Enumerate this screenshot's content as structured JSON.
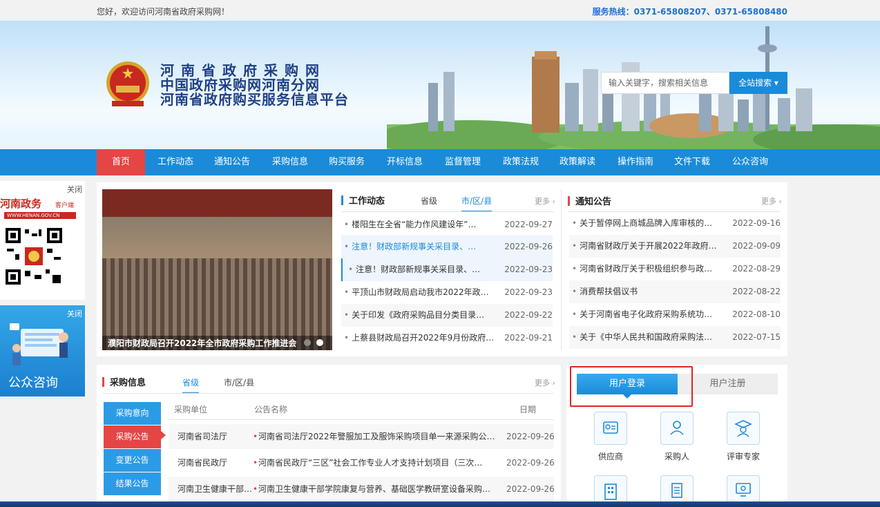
{
  "topbar": {
    "welcome": "您好，欢迎访问河南省政府采购网！",
    "hotline": "服务热线：0371-65808207、0371-65808480"
  },
  "header": {
    "title_lines": [
      "河南省政府采购网",
      "中国政府采购网河南分网",
      "河南省政府购买服务信息平台"
    ],
    "search_placeholder": "输入关键字，搜索相关信息",
    "search_button": "全站搜索"
  },
  "nav": {
    "items": [
      "首页",
      "工作动态",
      "通知公告",
      "采购信息",
      "购买服务",
      "开标信息",
      "监督管理",
      "政策法规",
      "政策解读",
      "操作指南",
      "文件下载",
      "公众咨询"
    ]
  },
  "left_ads": {
    "close": "关闭",
    "brand": "河南政务",
    "brand_suffix": "客户端",
    "url": "WWW.HENAN.GOV.CN",
    "close2": "关闭",
    "consult": "公众咨询"
  },
  "photo": {
    "caption": "濮阳市财政局召开2022年全市政府采购工作推进会"
  },
  "work_news": {
    "title": "工作动态",
    "tabs": [
      "省级",
      "市/区/县"
    ],
    "more": "更多",
    "items": [
      {
        "text": "楼阳生在全省“能力作风建设年”…",
        "date": "2022-09-27"
      },
      {
        "text": "注意！财政部新规事关采目录、…",
        "date": "2022-09-26"
      },
      {
        "text": "注意！财政部新规事关采目录、…",
        "date": "2022-09-23"
      },
      {
        "text": "平顶山市财政局启动我市2022年政…",
        "date": "2022-09-23"
      },
      {
        "text": "关于印发《政府采购品目分类目录…",
        "date": "2022-09-22"
      },
      {
        "text": "上蔡县财政局召开2022年9月份政府…",
        "date": "2022-09-21"
      }
    ]
  },
  "notices": {
    "title": "通知公告",
    "more": "更多",
    "items": [
      {
        "text": "关于暂停网上商城品牌入库审核的…",
        "date": "2022-09-16"
      },
      {
        "text": "河南省财政厅关于开展2022年政府…",
        "date": "2022-09-09"
      },
      {
        "text": "河南省财政厅关于积极组织参与政…",
        "date": "2022-08-29"
      },
      {
        "text": "消费帮扶倡议书",
        "date": "2022-08-22"
      },
      {
        "text": "关于河南省电子化政府采购系统功…",
        "date": "2022-08-10"
      },
      {
        "text": "关于《中华人民共和国政府采购法…",
        "date": "2022-07-15"
      }
    ]
  },
  "procurement": {
    "title": "采购信息",
    "tabs": [
      "省级",
      "市/区/县"
    ],
    "more": "更多",
    "menu": [
      "采购意向",
      "采购公告",
      "变更公告",
      "结果公告"
    ],
    "col_unit": "采购单位",
    "col_name": "公告名称",
    "col_date": "日期",
    "rows": [
      {
        "unit": "河南省司法厅",
        "name": "河南省司法厅2022年警服加工及服饰采购项目单一来源采购公…",
        "date": "2022-09-26"
      },
      {
        "unit": "河南省民政厅",
        "name": "河南省民政厅“三区”社会工作专业人才支持计划项目（三次…",
        "date": "2022-09-26"
      },
      {
        "unit": "河南卫生健康干部…",
        "name": "河南卫生健康干部学院康复与营养、基础医学教研室设备采购…",
        "date": "2022-09-26"
      }
    ]
  },
  "user": {
    "login": "用户登录",
    "register": "用户注册",
    "roles": [
      "供应商",
      "采购人",
      "评审专家"
    ]
  },
  "colors": {
    "primary": "#1a8bd8",
    "accent_red": "#e64545"
  }
}
